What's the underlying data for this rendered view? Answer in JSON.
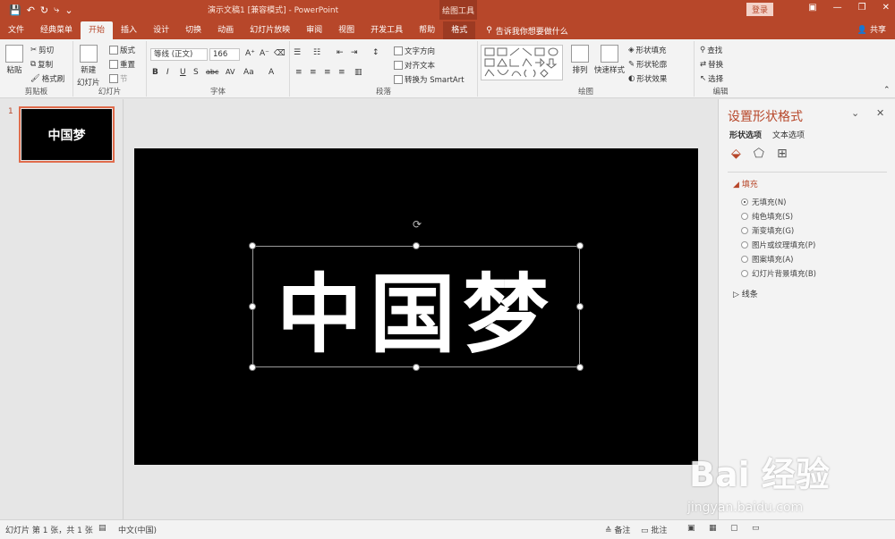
{
  "titlebar": {
    "qat": [
      "💾",
      "↶",
      "↻",
      "⤷",
      "⌄"
    ],
    "doc_title": "演示文稿1 [兼容模式] - PowerPoint",
    "context_group": "绘图工具",
    "login": "登录"
  },
  "tabs": [
    "文件",
    "经典菜单",
    "开始",
    "插入",
    "设计",
    "切换",
    "动画",
    "幻灯片放映",
    "审阅",
    "视图",
    "开发工具",
    "帮助",
    "格式"
  ],
  "tellme": "告诉我你想要做什么",
  "share": "共享",
  "ribbon": {
    "clipboard": {
      "label": "剪贴板",
      "paste": "粘贴",
      "cut": "剪切",
      "copy": "复制",
      "painter": "格式刷"
    },
    "slides": {
      "label": "幻灯片",
      "new": "新建",
      "new2": "幻灯片",
      "layout": "版式",
      "reset": "重置",
      "section": "节"
    },
    "font": {
      "label": "字体",
      "name": "等线 (正文)",
      "size": "166",
      "buttons": [
        "B",
        "I",
        "U",
        "S",
        "abc",
        "AV",
        "Aa",
        "A"
      ]
    },
    "paragraph": {
      "label": "段落",
      "text_dir": "文字方向",
      "align_text": "对齐文本",
      "smartart": "转换为 SmartArt"
    },
    "drawing": {
      "label": "绘图",
      "arrange": "排列",
      "quick_styles": "快速样式",
      "fill": "形状填充",
      "outline": "形状轮廓",
      "effects": "形状效果"
    },
    "editing": {
      "label": "编辑",
      "find": "查找",
      "replace": "替换",
      "select": "选择"
    }
  },
  "thumbnail": {
    "number": "1",
    "text": "中国梦"
  },
  "slide": {
    "text": "中国梦"
  },
  "format_pane": {
    "title": "设置形状格式",
    "tabs": [
      "形状选项",
      "文本选项"
    ],
    "fill_section": "填充",
    "fill_options": [
      "无填充(N)",
      "纯色填充(S)",
      "渐变填充(G)",
      "图片或纹理填充(P)",
      "图案填充(A)",
      "幻灯片背景填充(B)"
    ],
    "selected_fill": "无填充(N)",
    "line_section": "线条"
  },
  "statusbar": {
    "slide_info": "幻灯片 第 1 张，共 1 张",
    "language": "中文(中国)",
    "notes": "备注",
    "comments": "批注"
  },
  "watermark": {
    "brand": "Bai 经验",
    "url": "jingyan.baidu.com"
  }
}
